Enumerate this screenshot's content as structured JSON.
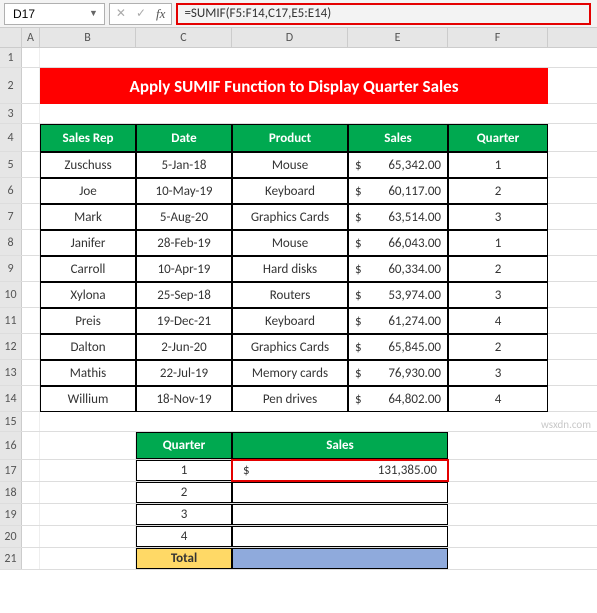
{
  "toolbar": {
    "namebox_value": "D17",
    "fx_label": "fx",
    "formula": "=SUMIF(F5:F14,C17,E5:E14)"
  },
  "columns": {
    "A": "A",
    "B": "B",
    "C": "C",
    "D": "D",
    "E": "E",
    "F": "F"
  },
  "row_nums": {
    "r1": "1",
    "r2": "2",
    "r3": "3",
    "r4": "4",
    "r5": "5",
    "r6": "6",
    "r7": "7",
    "r8": "8",
    "r9": "9",
    "r10": "10",
    "r11": "11",
    "r12": "12",
    "r13": "13",
    "r14": "14",
    "r15": "15",
    "r16": "16",
    "r17": "17",
    "r18": "18",
    "r19": "19",
    "r20": "20",
    "r21": "21"
  },
  "title": "Apply SUMIF Function to Display Quarter Sales",
  "main_headers": {
    "rep": "Sales Rep",
    "date": "Date",
    "product": "Product",
    "sales": "Sales",
    "quarter": "Quarter"
  },
  "rows": [
    {
      "rep": "Zuschuss",
      "date": "5-Jan-18",
      "product": "Mouse",
      "cur": "$",
      "sales": "65,342.00",
      "q": "1"
    },
    {
      "rep": "Joe",
      "date": "10-May-19",
      "product": "Keyboard",
      "cur": "$",
      "sales": "60,117.00",
      "q": "2"
    },
    {
      "rep": "Mark",
      "date": "5-Aug-20",
      "product": "Graphics Cards",
      "cur": "$",
      "sales": "63,514.00",
      "q": "3"
    },
    {
      "rep": "Janifer",
      "date": "28-Feb-19",
      "product": "Mouse",
      "cur": "$",
      "sales": "66,043.00",
      "q": "1"
    },
    {
      "rep": "Carroll",
      "date": "10-Apr-19",
      "product": "Hard disks",
      "cur": "$",
      "sales": "60,334.00",
      "q": "2"
    },
    {
      "rep": "Xylona",
      "date": "25-Sep-18",
      "product": "Routers",
      "cur": "$",
      "sales": "53,974.00",
      "q": "3"
    },
    {
      "rep": "Preis",
      "date": "19-Dec-21",
      "product": "Keyboard",
      "cur": "$",
      "sales": "61,274.00",
      "q": "4"
    },
    {
      "rep": "Dalton",
      "date": "2-Jun-20",
      "product": "Graphics Cards",
      "cur": "$",
      "sales": "65,845.00",
      "q": "2"
    },
    {
      "rep": "Mathis",
      "date": "22-Jul-19",
      "product": "Memory cards",
      "cur": "$",
      "sales": "76,930.00",
      "q": "3"
    },
    {
      "rep": "Willium",
      "date": "18-Nov-19",
      "product": "Pen drives",
      "cur": "$",
      "sales": "64,802.00",
      "q": "4"
    }
  ],
  "summary": {
    "hdr_quarter": "Quarter",
    "hdr_sales": "Sales",
    "rows": [
      {
        "q": "1",
        "cur": "$",
        "sales": "131,385.00"
      },
      {
        "q": "2",
        "cur": "",
        "sales": ""
      },
      {
        "q": "3",
        "cur": "",
        "sales": ""
      },
      {
        "q": "4",
        "cur": "",
        "sales": ""
      }
    ],
    "total_label": "Total"
  },
  "watermark": "wsxdn.com"
}
